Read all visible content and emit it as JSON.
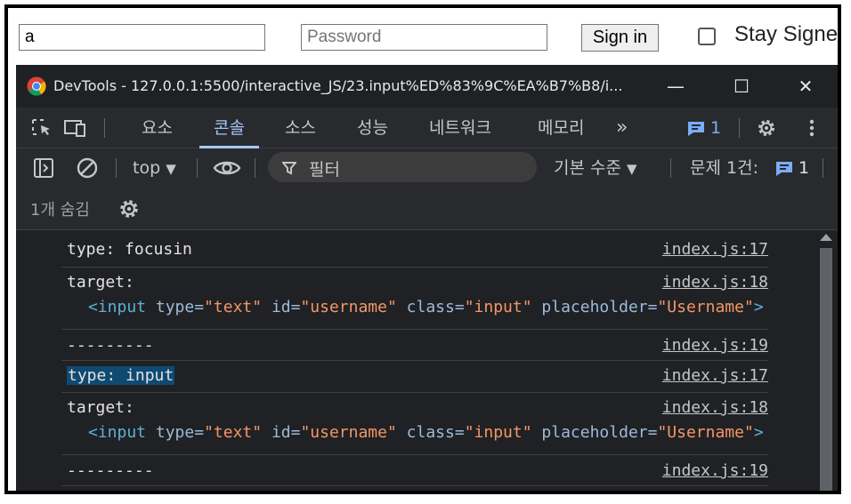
{
  "page": {
    "username_value": "a",
    "password_placeholder": "Password",
    "signin_label": "Sign in",
    "stay_label": "Stay Signe"
  },
  "devtools": {
    "title": "DevTools - 127.0.0.1:5500/interactive_JS/23.input%ED%83%9C%EA%B7%B8/i...",
    "window_buttons": {
      "minimize": "—",
      "maximize": "☐",
      "close": "✕"
    },
    "tabs": [
      {
        "label": "요소",
        "active": false
      },
      {
        "label": "콘솔",
        "active": true
      },
      {
        "label": "소스",
        "active": false
      },
      {
        "label": "성능",
        "active": false
      },
      {
        "label": "네트워크",
        "active": false
      },
      {
        "label": "메모리",
        "active": false
      }
    ],
    "more_tabs": "»",
    "message_badge_count": "1",
    "toolbar": {
      "context": "top",
      "filter_placeholder": "필터",
      "level": "기본 수준",
      "issues_label": "문제 1건:",
      "issues_count": "1"
    },
    "hidden_count": "1개 숨김"
  },
  "console": {
    "messages": [
      {
        "line1": "type: focusin",
        "link": "index.js:17"
      },
      {
        "line1": "target:",
        "line2": {
          "open": "<input",
          "type_attr": "type=",
          "type_val": "\"text\"",
          "id_attr": "id=",
          "id_val": "\"username\"",
          "class_attr": "class=",
          "class_val": "\"input\"",
          "ph_attr": "placeholder=",
          "ph_val": "\"Username\"",
          "close": ">"
        },
        "link": "index.js:18"
      },
      {
        "line1": "---------",
        "link": "index.js:19"
      },
      {
        "line1": "type: input",
        "link": "index.js:17"
      },
      {
        "line1": "target:",
        "line2": {
          "open": "<input",
          "type_attr": "type=",
          "type_val": "\"text\"",
          "id_attr": "id=",
          "id_val": "\"username\"",
          "class_attr": "class=",
          "class_val": "\"input\"",
          "ph_attr": "placeholder=",
          "ph_val": "\"Username\"",
          "close": ">"
        },
        "link": "index.js:18"
      },
      {
        "line1": "---------",
        "link": "index.js:19"
      }
    ]
  }
}
